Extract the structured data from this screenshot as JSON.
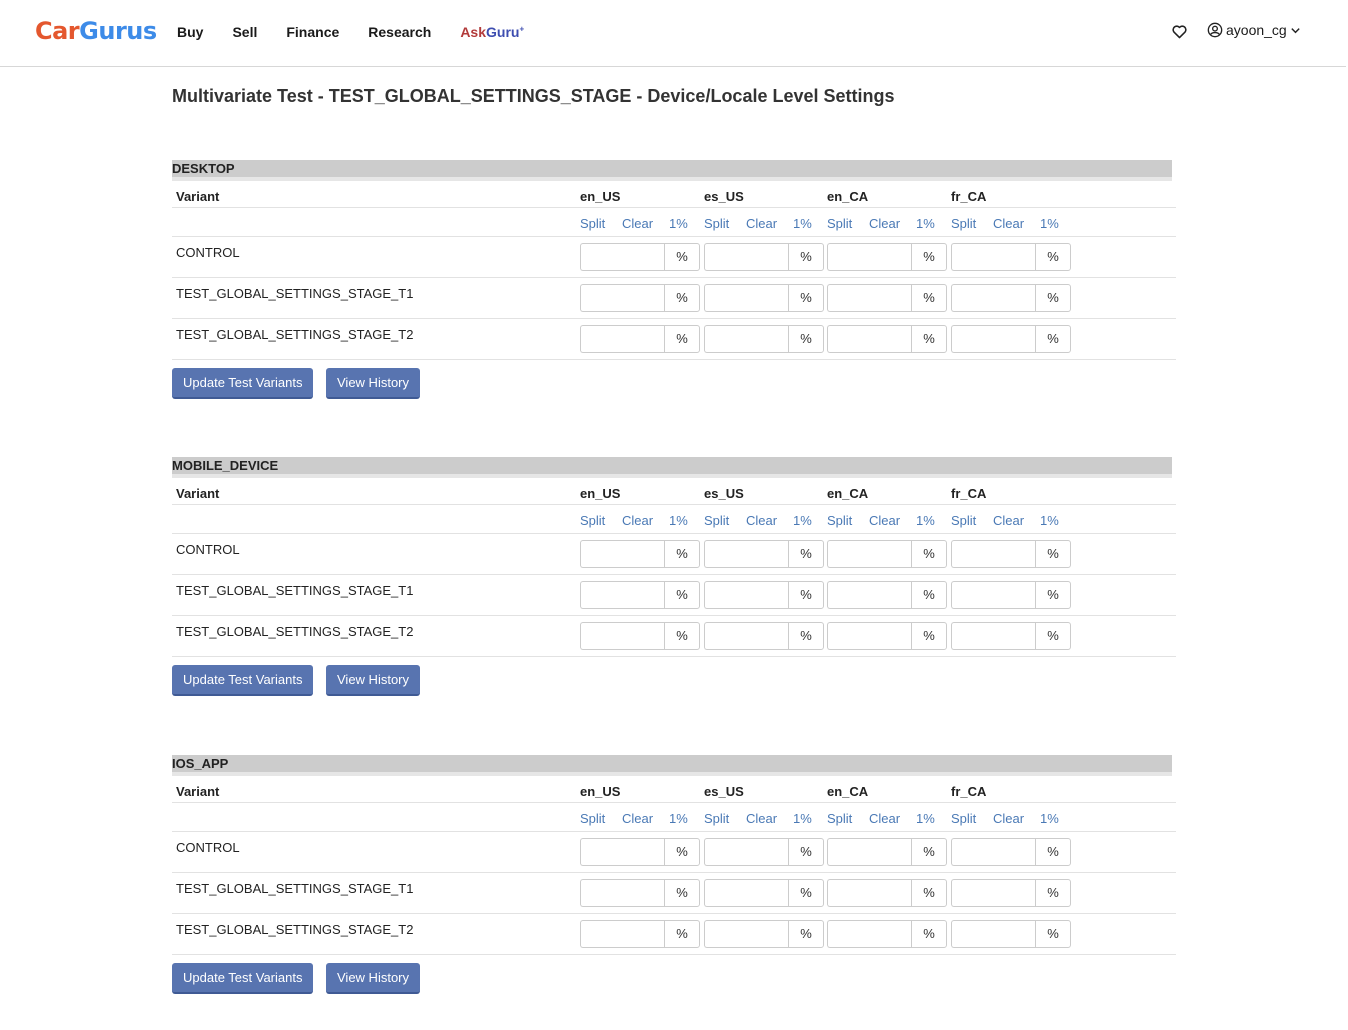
{
  "header": {
    "logo_part1": "Car",
    "logo_part2": "Gurus",
    "nav": [
      "Buy",
      "Sell",
      "Finance",
      "Research"
    ],
    "ask_part1": "Ask",
    "ask_part2": "Guru",
    "ask_sup": "+",
    "user": "ayoon_cg"
  },
  "page_title": "Multivariate Test - TEST_GLOBAL_SETTINGS_STAGE - Device/Locale Level Settings",
  "column_header": "Variant",
  "locales": [
    "en_US",
    "es_US",
    "en_CA",
    "fr_CA"
  ],
  "locale_controls": {
    "split": "Split",
    "clear": "Clear",
    "one_percent": "1%"
  },
  "variants": [
    "CONTROL",
    "TEST_GLOBAL_SETTINGS_STAGE_T1",
    "TEST_GLOBAL_SETTINGS_STAGE_T2"
  ],
  "percent_addon": "%",
  "input_values": {},
  "buttons": {
    "update": "Update Test Variants",
    "history": "View History"
  },
  "sections": [
    {
      "name": "DESKTOP"
    },
    {
      "name": "MOBILE_DEVICE"
    },
    {
      "name": "IOS_APP"
    }
  ]
}
